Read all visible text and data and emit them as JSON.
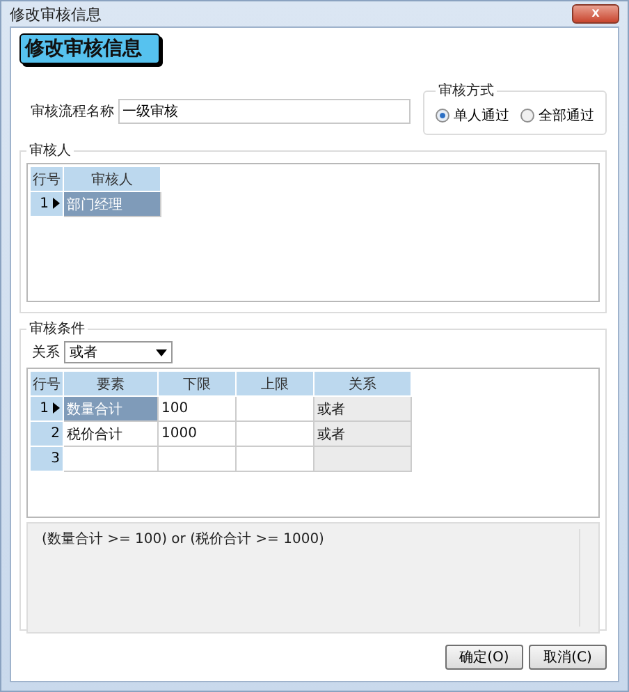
{
  "window": {
    "title": "修改审核信息",
    "close": "x"
  },
  "header": "修改审核信息",
  "flow_name": {
    "label": "审核流程名称",
    "value": "一级审核"
  },
  "mode": {
    "title": "审核方式",
    "options": [
      {
        "label": "单人通过",
        "selected": true
      },
      {
        "label": "全部通过",
        "selected": false
      }
    ]
  },
  "reviewers": {
    "title": "审核人",
    "columns": [
      "行号",
      "审核人"
    ],
    "rows": [
      {
        "current": true,
        "cells": [
          {
            "text": "1"
          },
          {
            "text": "部门经理",
            "selected": true
          }
        ]
      }
    ]
  },
  "conditions": {
    "title": "审核条件",
    "relation_label": "关系",
    "relation_value": "或者",
    "columns": [
      "行号",
      "要素",
      "下限",
      "上限",
      "关系"
    ],
    "rows": [
      {
        "current": true,
        "cells": [
          {
            "text": "1"
          },
          {
            "text": "数量合计",
            "selected": true
          },
          {
            "text": "100",
            "selected": false
          },
          {
            "text": "",
            "selected": false
          },
          {
            "text": "或者",
            "selected": false
          }
        ]
      },
      {
        "current": false,
        "cells": [
          {
            "text": "2"
          },
          {
            "text": "税价合计",
            "selected": false
          },
          {
            "text": "1000",
            "selected": false
          },
          {
            "text": "",
            "selected": false
          },
          {
            "text": "或者",
            "selected": false
          }
        ]
      },
      {
        "current": false,
        "cells": [
          {
            "text": "3"
          },
          {
            "text": "",
            "selected": false
          },
          {
            "text": "",
            "selected": false
          },
          {
            "text": "",
            "selected": false
          },
          {
            "text": "",
            "selected": false
          }
        ]
      }
    ],
    "expression": "(数量合计 >= 100) or (税价合计 >= 1000)"
  },
  "buttons": [
    "确定(O)",
    "取消(C)"
  ]
}
